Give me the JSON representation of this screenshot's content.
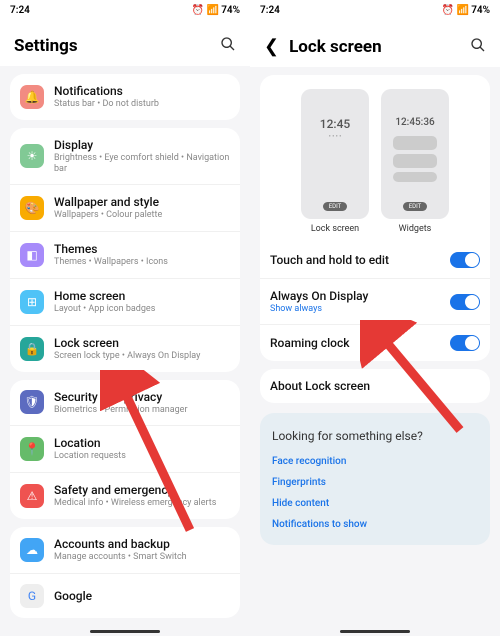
{
  "status": {
    "time": "7:24",
    "battery": "74%"
  },
  "left": {
    "title": "Settings",
    "items": [
      {
        "label": "Notifications",
        "sub": "Status bar  •  Do not disturb",
        "color": "#f28b82"
      },
      {
        "label": "Display",
        "sub": "Brightness  •  Eye comfort shield  •  Navigation bar",
        "color": "#81c995"
      },
      {
        "label": "Wallpaper and style",
        "sub": "Wallpapers  •  Colour palette",
        "color": "#f9ab00"
      },
      {
        "label": "Themes",
        "sub": "Themes  •  Wallpapers  •  Icons",
        "color": "#a78bfa"
      },
      {
        "label": "Home screen",
        "sub": "Layout  •  App icon badges",
        "color": "#4fc3f7"
      },
      {
        "label": "Lock screen",
        "sub": "Screen lock type  •  Always On Display",
        "color": "#26a69a"
      },
      {
        "label": "Security and privacy",
        "sub": "Biometrics  •  Permission manager",
        "color": "#5c6bc0"
      },
      {
        "label": "Location",
        "sub": "Location requests",
        "color": "#66bb6a"
      },
      {
        "label": "Safety and emergency",
        "sub": "Medical info  •  Wireless emergency alerts",
        "color": "#ef5350"
      },
      {
        "label": "Accounts and backup",
        "sub": "Manage accounts  •  Smart Switch",
        "color": "#42a5f5"
      },
      {
        "label": "Google",
        "sub": "",
        "color": "#9e9e9e"
      }
    ]
  },
  "right": {
    "title": "Lock screen",
    "preview": {
      "lock": {
        "time": "12:45",
        "edit": "EDIT",
        "label": "Lock screen"
      },
      "widgets": {
        "time": "12:45:36",
        "edit": "EDIT",
        "label": "Widgets"
      }
    },
    "toggles": [
      {
        "label": "Touch and hold to edit",
        "sub": ""
      },
      {
        "label": "Always On Display",
        "sub": "Show always"
      },
      {
        "label": "Roaming clock",
        "sub": ""
      }
    ],
    "about": "About Lock screen",
    "tip": {
      "title": "Looking for something else?",
      "links": [
        "Face recognition",
        "Fingerprints",
        "Hide content",
        "Notifications to show"
      ]
    }
  }
}
